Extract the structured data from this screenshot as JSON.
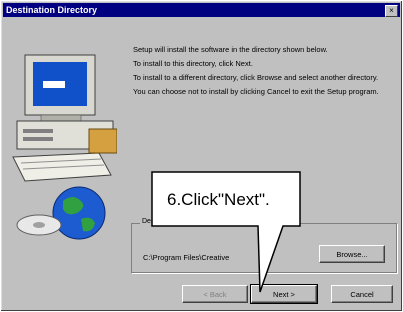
{
  "window": {
    "title": "Destination Directory",
    "close_glyph": "×"
  },
  "content": {
    "paragraphs": [
      "Setup will install the software in the directory shown below.",
      "To install to this directory, click Next.",
      "To install to a different directory, click Browse and select another directory.",
      "You can choose not to install by clicking Cancel to exit the Setup program."
    ]
  },
  "destination": {
    "group_label": "Destination Folder",
    "path": "C:\\Program Files\\Creative"
  },
  "buttons": {
    "browse": "Browse...",
    "back": "< Back",
    "next": "Next >",
    "cancel": "Cancel"
  },
  "annotation": {
    "callout_text": "6.Click\"Next\"."
  },
  "colors": {
    "titlebar": "#000080",
    "dialog_bg": "#c0c0c0"
  }
}
